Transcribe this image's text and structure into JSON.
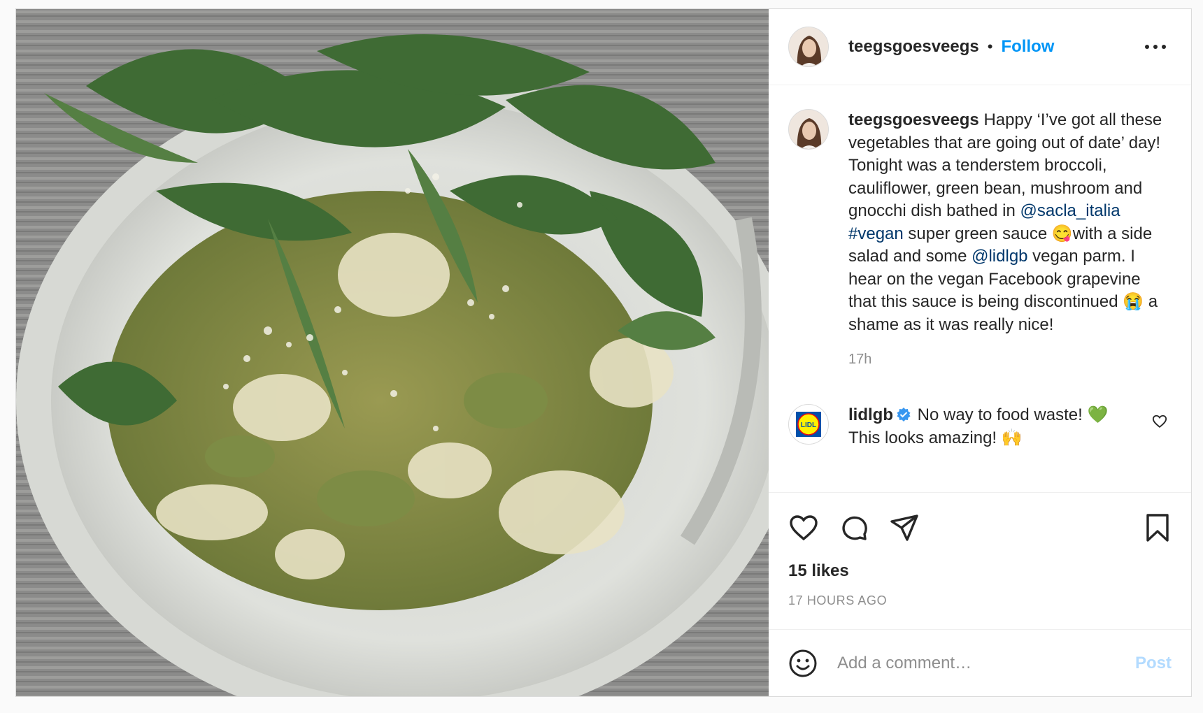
{
  "post": {
    "username": "teegsgoesveegs",
    "separator": "•",
    "follow_label": "Follow",
    "more_icon": "more-horizontal-icon"
  },
  "caption": {
    "username": "teegsgoesveegs",
    "text_1": "Happy ‘I’ve got all these vegetables that are going out of date’ day! Tonight was a tenderstem broccoli, cauliflower, green bean, mushroom and gnocchi dish bathed in ",
    "mention_1": "@sacla_italia",
    "hashtag_1": "#vegan",
    "text_2": " super green sauce ",
    "emoji_1": "😋",
    "text_3": "with a side salad and some ",
    "mention_2": "@lidlgb",
    "text_4": " vegan parm. I hear on the vegan Facebook grapevine that this sauce is being discontinued ",
    "emoji_2": "😭",
    "text_5": " a shame as it was really nice!",
    "time": "17h"
  },
  "comment": {
    "username": "lidlgb",
    "verified": true,
    "text_1": " No way to food waste! ",
    "emoji_1": "💚",
    "text_2": " This looks amazing! ",
    "emoji_2": "🙌",
    "logo_text": "LIDL"
  },
  "actions": {
    "icons": [
      "heart-icon",
      "comment-icon",
      "share-icon",
      "bookmark-icon"
    ],
    "likes": "15 likes",
    "timestamp": "17 HOURS AGO"
  },
  "add_comment": {
    "placeholder": "Add a comment…",
    "post_label": "Post"
  },
  "colors": {
    "link": "#00376b",
    "follow": "#0095f6",
    "post_disabled": "#b3dbff",
    "muted": "#8e8e8e"
  }
}
